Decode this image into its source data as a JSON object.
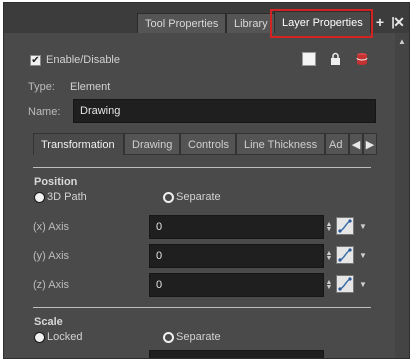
{
  "tabs": [
    {
      "label": "Tool Properties"
    },
    {
      "label": "Library"
    },
    {
      "label": "Layer Properties"
    }
  ],
  "enable_label": "Enable/Disable",
  "type_label": "Type:",
  "type_value": "Element",
  "name_label": "Name:",
  "name_value": "Drawing",
  "subtabs": [
    {
      "label": "Transformation"
    },
    {
      "label": "Drawing"
    },
    {
      "label": "Controls"
    },
    {
      "label": "Line Thickness"
    },
    {
      "label": "Ad"
    }
  ],
  "position": {
    "title": "Position",
    "option_3d": "3D Path",
    "option_separate": "Separate",
    "x_label": "(x) Axis",
    "x_value": "0",
    "y_label": "(y) Axis",
    "y_value": "0",
    "z_label": "(z) Axis",
    "z_value": "0"
  },
  "scale": {
    "title": "Scale",
    "option_locked": "Locked",
    "option_separate": "Separate"
  },
  "icons": [
    "close-icon",
    "add-icon",
    "lock-icon",
    "database-icon",
    "color-swatch-icon",
    "curve-function-icon",
    "dropdown-arrow-icon",
    "spin-arrows-icon"
  ],
  "colors": {
    "highlight": "#d42323",
    "panel": "#4a4a4a",
    "field": "#1f1f1f"
  }
}
